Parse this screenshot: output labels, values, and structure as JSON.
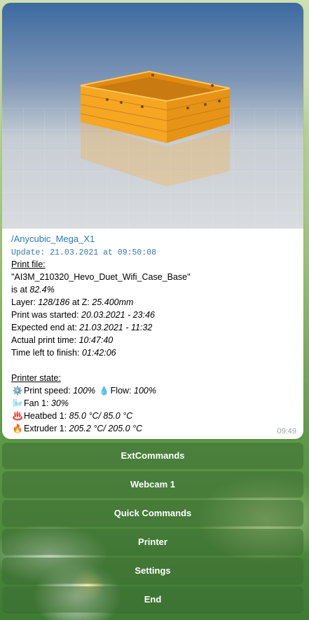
{
  "message": {
    "path": "/Anycubic_Mega_X1",
    "update": "Update: 21.03.2021 at 09:50:08",
    "print_file_label": "Print file:",
    "file_name": "\"AI3M_210320_Hevo_Duet_Wifi_Case_Base\"",
    "is_at_label": "is at ",
    "progress": "82.4%",
    "layer_label": "Layer: ",
    "layer_value": "128/186",
    "at_z_label": " at Z: ",
    "z_value": "25.400mm",
    "started_label": "Print was started: ",
    "started_value": "20.03.2021 - 23:46",
    "expected_label": "Expected end at: ",
    "expected_value": "21.03.2021 - 11:32",
    "actual_label": "Actual print time: ",
    "actual_value": "10:47:40",
    "left_label": "Time left to finish: ",
    "left_value": "01:42:06",
    "printer_state_label": "Printer state:",
    "speed_label": "Print speed: ",
    "speed_value": "100%",
    "flow_label": "Flow: ",
    "flow_value": "100%",
    "fan_label": "Fan 1: ",
    "fan_value": "30%",
    "heatbed_label": "Heatbed 1: ",
    "heatbed_value": "85.0 °C/ 85.0 °C",
    "extruder_label": "Extruder 1: ",
    "extruder_value": "205.2 °C/ 205.0 °C",
    "time": "09:49"
  },
  "icons": {
    "speed": "gear-icon",
    "flow": "droplet-icon",
    "fan": "fan-icon",
    "heatbed": "hot-springs-icon",
    "extruder": "fire-icon"
  },
  "keyboard": [
    {
      "label": "ExtCommands"
    },
    {
      "label": "Webcam 1"
    },
    {
      "label": "Quick Commands"
    },
    {
      "label": "Printer"
    },
    {
      "label": "Settings"
    },
    {
      "label": "End"
    }
  ],
  "colors": {
    "link": "#2a7ab4",
    "model_orange": "#f0a020"
  }
}
